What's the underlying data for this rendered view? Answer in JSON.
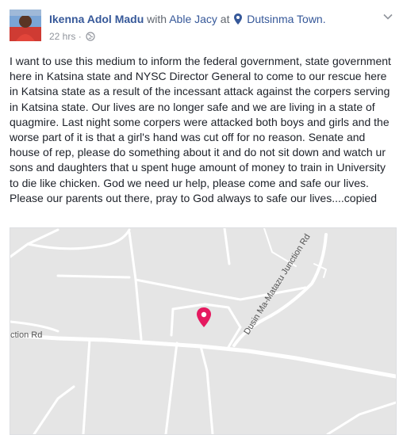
{
  "post": {
    "author": "Ikenna Adol Madu",
    "with_text": "with",
    "tagged": "Able Jacy",
    "at_text": "at",
    "location": "Dutsinma Town.",
    "time": "22 hrs",
    "separator": "·",
    "body": "I want to use this medium to inform the federal government, state government here in Katsina state and NYSC Director General to come to our rescue here in Katsina state as a result of the incessant attack against the corpers serving in Katsina state. Our lives are no longer safe and we are living in a state of quagmire. Last night some corpers were attacked both boys and girls and the worse part of it is that a girl's hand was cut off for no reason. Senate and house of rep, please do something about it and do not sit down and watch ur sons and daughters that u spent huge amount of money to train in University to die like chicken. God we need ur help, please come and safe our lives. Please our parents out there, pray to God always to safe our lives....copied"
  },
  "map": {
    "road_1": "Dusin Ma-Matazu Junction Rd",
    "road_2": "ction Rd",
    "pin_color": "#e5195f"
  },
  "icons": {
    "privacy": "globe-icon",
    "location": "location-pin-icon",
    "menu": "chevron-down-icon"
  }
}
